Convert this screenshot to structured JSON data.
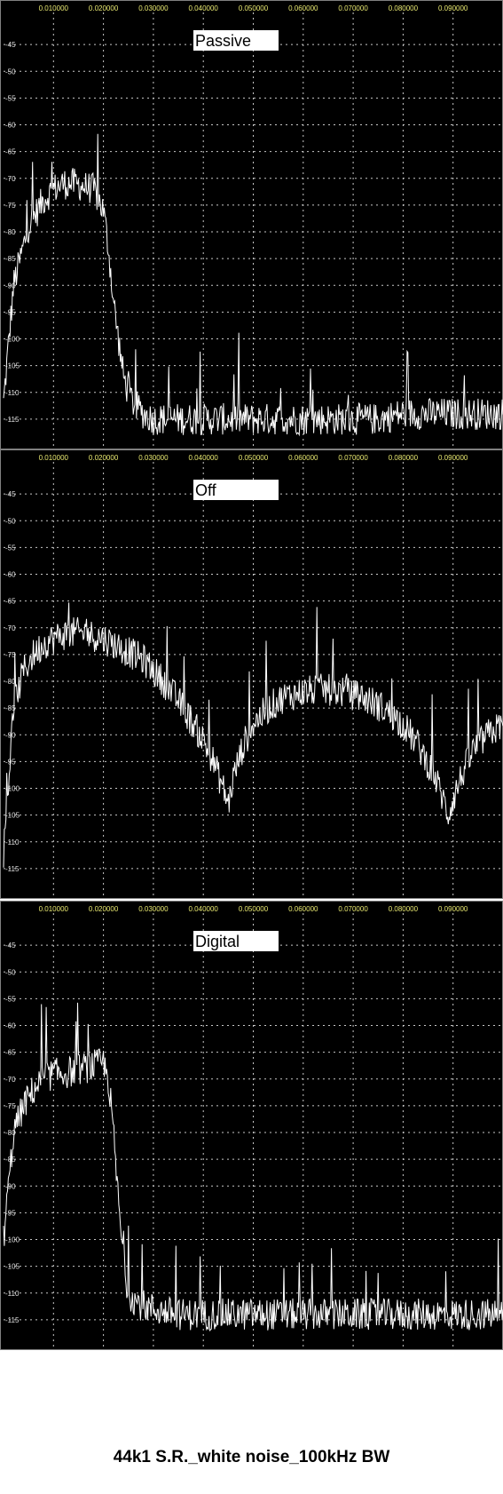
{
  "chart_data": [
    {
      "type": "line",
      "label": "Passive",
      "x_ticks": [
        "0.010000",
        "0.020000",
        "0.030000",
        "0.040000",
        "0.050000",
        "0.060000",
        "0.070000",
        "0.080000",
        "0.090000"
      ],
      "y_ticks": [
        "-45",
        "-50",
        "-55",
        "-60",
        "-65",
        "-70",
        "-75",
        "-80",
        "-85",
        "-90",
        "-95",
        "-100",
        "-105",
        "-110",
        "-115"
      ],
      "xlim": [
        0,
        0.1
      ],
      "ylim": [
        -120,
        -40
      ],
      "grid": true,
      "series": [
        {
          "x": [
            0,
            0.002,
            0.005,
            0.008,
            0.01,
            0.012,
            0.014,
            0.016,
            0.018,
            0.02,
            0.021,
            0.022,
            0.023,
            0.024,
            0.025,
            0.026,
            0.028,
            0.03,
            0.035,
            0.04,
            0.045,
            0.05,
            0.055,
            0.06,
            0.065,
            0.07,
            0.075,
            0.08,
            0.085,
            0.09,
            0.095,
            0.1
          ],
          "y": [
            -112,
            -90,
            -79,
            -74,
            -72,
            -71,
            -71,
            -71.5,
            -72,
            -76,
            -83,
            -93,
            -100,
            -107,
            -110,
            -112,
            -114,
            -115,
            -115,
            -115,
            -115,
            -115,
            -115,
            -115,
            -115,
            -115,
            -115,
            -114,
            -114,
            -114,
            -114,
            -114
          ]
        }
      ]
    },
    {
      "type": "line",
      "label": "Off",
      "x_ticks": [
        "0.010000",
        "0.020000",
        "0.030000",
        "0.040000",
        "0.050000",
        "0.060000",
        "0.070000",
        "0.080000",
        "0.090000"
      ],
      "y_ticks": [
        "-45",
        "-50",
        "-55",
        "-60",
        "-65",
        "-70",
        "-75",
        "-80",
        "-85",
        "-90",
        "-95",
        "-100",
        "-105",
        "-110",
        "-115"
      ],
      "xlim": [
        0,
        0.1
      ],
      "ylim": [
        -120,
        -40
      ],
      "grid": true,
      "series": [
        {
          "x": [
            0,
            0.002,
            0.004,
            0.006,
            0.008,
            0.01,
            0.013,
            0.016,
            0.02,
            0.024,
            0.028,
            0.032,
            0.036,
            0.04,
            0.042,
            0.044,
            0.045,
            0.046,
            0.048,
            0.05,
            0.053,
            0.056,
            0.06,
            0.064,
            0.068,
            0.072,
            0.076,
            0.08,
            0.083,
            0.086,
            0.088,
            0.089,
            0.09,
            0.092,
            0.094,
            0.097,
            0.1
          ],
          "y": [
            -112,
            -85,
            -78,
            -75,
            -73,
            -72,
            -71,
            -71,
            -72,
            -74,
            -76,
            -80,
            -85,
            -91,
            -95,
            -100,
            -103,
            -98,
            -92,
            -88,
            -85,
            -83,
            -82,
            -81.5,
            -82,
            -83,
            -85,
            -88,
            -92,
            -97,
            -102,
            -105,
            -102,
            -97,
            -93,
            -90,
            -88
          ]
        }
      ]
    },
    {
      "type": "line",
      "label": "Digital",
      "x_ticks": [
        "0.010000",
        "0.020000",
        "0.030000",
        "0.040000",
        "0.050000",
        "0.060000",
        "0.070000",
        "0.080000",
        "0.090000"
      ],
      "y_ticks": [
        "-45",
        "-50",
        "-55",
        "-60",
        "-65",
        "-70",
        "-75",
        "-80",
        "-85",
        "-90",
        "-95",
        "-100",
        "-105",
        "-110",
        "-115"
      ],
      "xlim": [
        0,
        0.1
      ],
      "ylim": [
        -120,
        -40
      ],
      "grid": true,
      "series": [
        {
          "x": [
            0,
            0.002,
            0.004,
            0.006,
            0.008,
            0.01,
            0.012,
            0.014,
            0.016,
            0.018,
            0.02,
            0.021,
            0.022,
            0.023,
            0.024,
            0.025,
            0.027,
            0.03,
            0.035,
            0.04,
            0.045,
            0.05,
            0.055,
            0.06,
            0.065,
            0.07,
            0.075,
            0.08,
            0.085,
            0.09,
            0.095,
            0.1
          ],
          "y": [
            -100,
            -80,
            -75,
            -72,
            -70,
            -69,
            -69,
            -68.5,
            -68,
            -67.5,
            -67,
            -70,
            -80,
            -93,
            -104,
            -110,
            -112,
            -113,
            -114,
            -114,
            -114,
            -114,
            -114,
            -114,
            -114,
            -114,
            -114,
            -114,
            -114,
            -114,
            -114,
            -114
          ]
        }
      ]
    }
  ],
  "caption": "44k1 S.R._white noise_100kHz BW",
  "colors": {
    "plot_bg": "#000000",
    "trace": "#ffffff",
    "grid": "#c8c8c8",
    "x_tick": "#e8e870",
    "y_tick": "#e0e0e0",
    "label_bg": "#ffffff",
    "frame": "#808080"
  }
}
